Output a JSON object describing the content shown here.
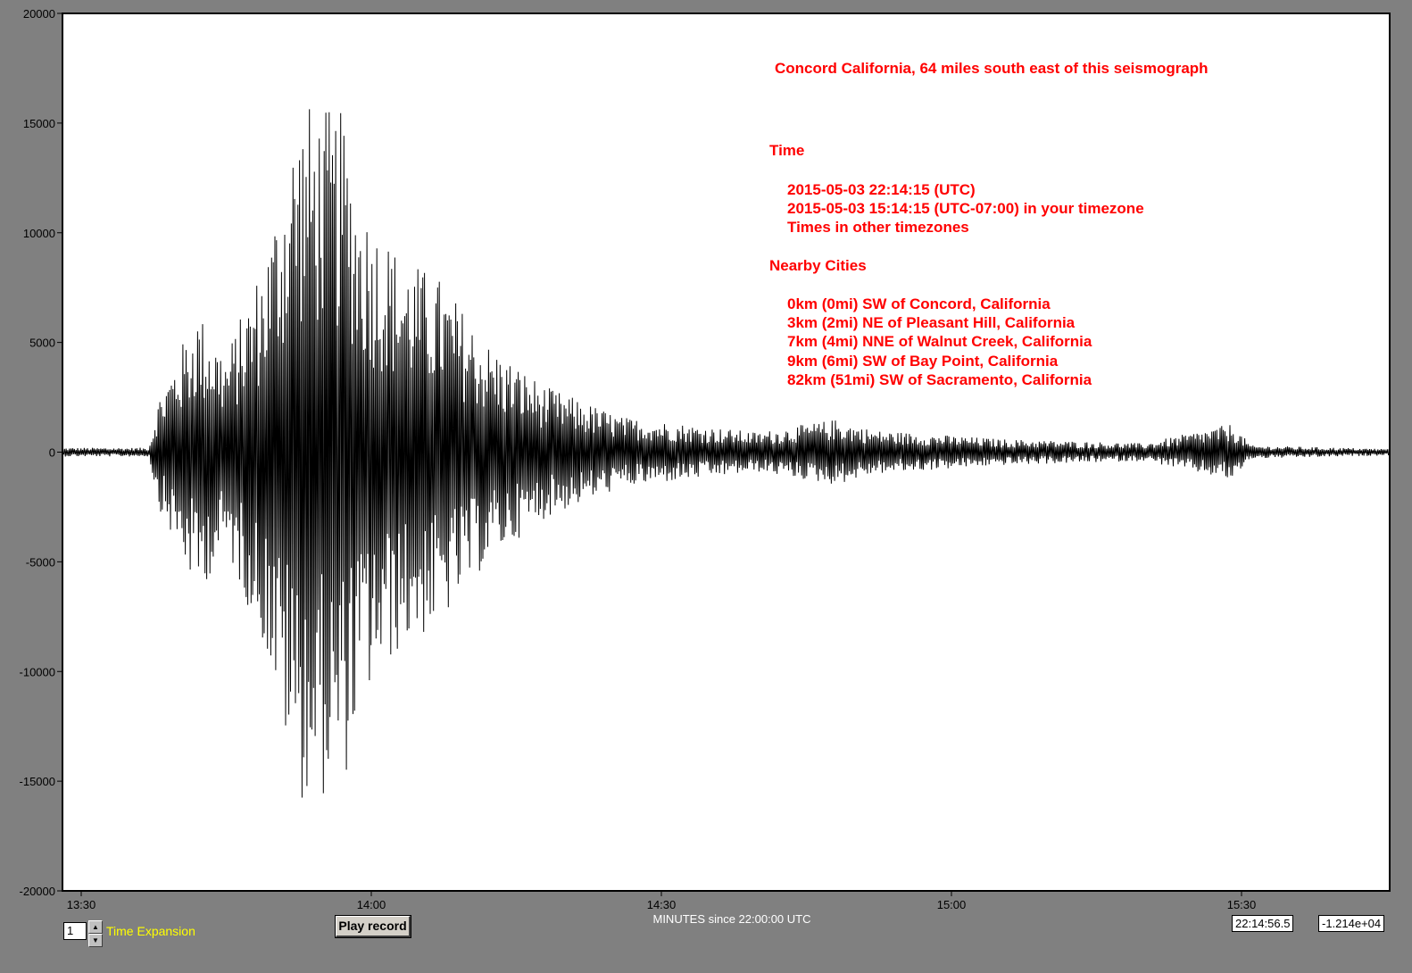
{
  "chart_data": {
    "type": "line",
    "title": "Concord California, 64 miles south east of this seismograph",
    "xlabel": "MINUTES since 22:00:00 UTC",
    "ylabel": "",
    "ylim": [
      -20000,
      20000
    ],
    "yticks": [
      20000,
      15000,
      10000,
      5000,
      0,
      -5000,
      -10000,
      -15000,
      -20000
    ],
    "xticks": [
      "13:30",
      "14:00",
      "14:30",
      "15:00",
      "15:30"
    ],
    "grid": false,
    "colors": {
      "trace": "#000000",
      "annotation": "#ff0000",
      "background": "#ffffff"
    },
    "annotations": {
      "time_heading": "Time",
      "utc_time": "2015-05-03 22:14:15 (UTC)",
      "local_time": "2015-05-03 15:14:15 (UTC-07:00) in your timezone",
      "other_timezones": "Times in other timezones",
      "cities_heading": "Nearby Cities",
      "cities": [
        "0km (0mi) SW of Concord, California",
        "3km (2mi) NE of Pleasant Hill, California",
        "7km (4mi) NNE of Walnut Creek, California",
        "9km (6mi) SW of Bay Point, California",
        "82km (51mi) SW of Sacramento, California"
      ]
    },
    "series": [
      {
        "envelope": [
          {
            "x": "13:30",
            "amp": 200
          },
          {
            "x": "13:37",
            "amp": 200
          },
          {
            "x": "13:38",
            "amp": 2500
          },
          {
            "x": "13:42",
            "amp": 6500
          },
          {
            "x": "13:45",
            "amp": 4500
          },
          {
            "x": "13:49",
            "amp": 9000
          },
          {
            "x": "13:52",
            "amp": 15000
          },
          {
            "x": "13:53",
            "amp": 16000
          },
          {
            "x": "13:57",
            "amp": 15500
          },
          {
            "x": "13:59",
            "amp": 11500
          },
          {
            "x": "14:03",
            "amp": 9000
          },
          {
            "x": "14:07",
            "amp": 8000
          },
          {
            "x": "14:12",
            "amp": 5000
          },
          {
            "x": "14:18",
            "amp": 3000
          },
          {
            "x": "14:26",
            "amp": 1600
          },
          {
            "x": "14:40",
            "amp": 900
          },
          {
            "x": "14:48",
            "amp": 1500
          },
          {
            "x": "14:52",
            "amp": 1000
          },
          {
            "x": "15:05",
            "amp": 600
          },
          {
            "x": "15:20",
            "amp": 400
          },
          {
            "x": "15:29",
            "amp": 1300
          },
          {
            "x": "15:31",
            "amp": 300
          },
          {
            "x": "15:45",
            "amp": 150
          }
        ]
      }
    ]
  },
  "controls": {
    "expansion_value": "1",
    "expansion_label": "Time Expansion",
    "play_label": "Play record",
    "time_readout": "22:14:56.5",
    "value_readout": "-1.214e+04"
  }
}
